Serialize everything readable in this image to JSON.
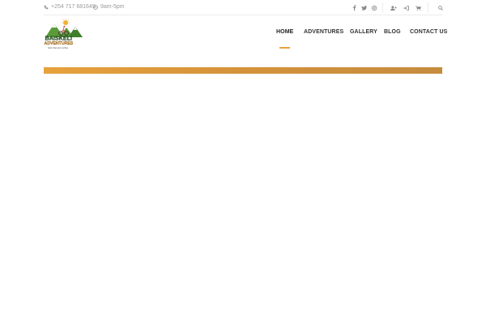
{
  "topbar": {
    "phone": "+254 717 681649",
    "hours": "9am-5pm",
    "icons": [
      "phone-icon",
      "clock-icon",
      "facebook-icon",
      "twitter-icon",
      "instagram-icon",
      "user-plus-icon",
      "login-icon",
      "cart-icon",
      "search-icon"
    ]
  },
  "brand": {
    "name_line1": "BAISKELI",
    "name_line2": "ADVENTURES",
    "tagline": "more than just cycling"
  },
  "nav": {
    "items": [
      {
        "label": "HOME"
      },
      {
        "label": "ADVENTURES"
      },
      {
        "label": "GALLERY"
      },
      {
        "label": "BLOG"
      },
      {
        "label": "CONTACT US"
      }
    ],
    "active_index": 0
  },
  "colors": {
    "accent": "#e8a33c",
    "banner_end": "#c58c3e",
    "text_muted": "#9a9a9a",
    "nav_text": "#333333"
  }
}
